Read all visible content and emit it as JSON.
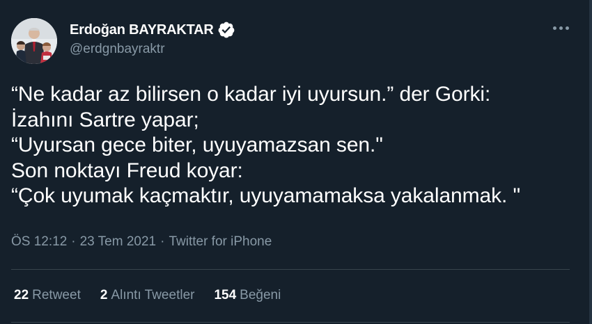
{
  "author": {
    "display_name": "Erdoğan BAYRAKTAR",
    "handle": "@erdgnbayraktr",
    "verified": true,
    "verified_color": "#ffffff"
  },
  "menu_icon": "more-horizontal-icon",
  "tweet": {
    "lines": [
      "“Ne kadar az bilirsen o kadar iyi uyursun.” der Gorki:",
      "İzahını Sartre yapar;",
      "“Uyursan gece biter, uyuyamazsan sen.\"",
      "Son noktayı Freud koyar:",
      "“Çok uyumak kaçmaktır, uyuyamamaksa yakalanmak. \""
    ]
  },
  "meta": {
    "time": "ÖS 12:12",
    "separator": "·",
    "date": "23 Tem 2021",
    "source": "Twitter for iPhone"
  },
  "stats": {
    "retweets": {
      "count": "22",
      "label": "Retweet"
    },
    "quotes": {
      "count": "2",
      "label": "Alıntı Tweetler"
    },
    "likes": {
      "count": "154",
      "label": "Beğeni"
    }
  },
  "colors": {
    "background": "#15202b",
    "secondary_text": "#8899a6",
    "divider": "#38444d"
  }
}
